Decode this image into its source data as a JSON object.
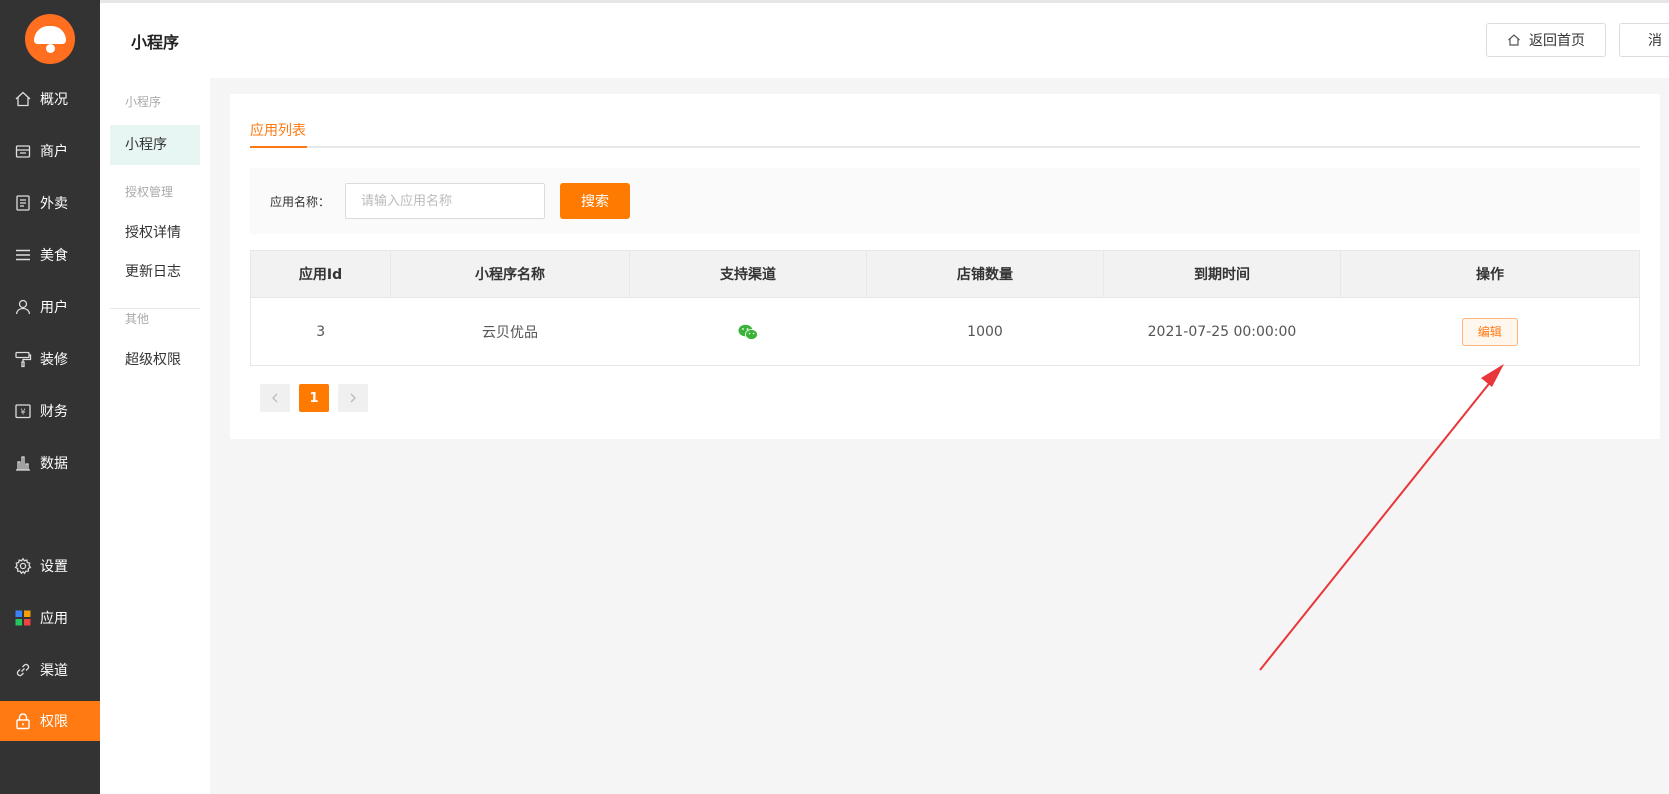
{
  "sidebar": {
    "items": [
      {
        "label": "概况",
        "icon": "home-icon"
      },
      {
        "label": "商户",
        "icon": "store-icon"
      },
      {
        "label": "外卖",
        "icon": "document-icon"
      },
      {
        "label": "美食",
        "icon": "menu-icon"
      },
      {
        "label": "用户",
        "icon": "user-icon"
      },
      {
        "label": "装修",
        "icon": "paint-roller-icon"
      },
      {
        "label": "财务",
        "icon": "wallet-icon"
      },
      {
        "label": "数据",
        "icon": "bar-chart-icon"
      },
      {
        "label": "设置",
        "icon": "gear-icon"
      },
      {
        "label": "应用",
        "icon": "apps-icon"
      },
      {
        "label": "渠道",
        "icon": "link-icon"
      },
      {
        "label": "权限",
        "icon": "lock-icon",
        "active": true
      }
    ],
    "accent_color": "#ff7a12"
  },
  "header": {
    "title": "小程序",
    "home_button": "返回首页",
    "notice_button": "消"
  },
  "subnav": {
    "group_miniapp": "小程序",
    "item_miniapp": "小程序",
    "group_auth": "授权管理",
    "item_auth_detail": "授权详情",
    "item_changelog": "更新日志",
    "group_other": "其他",
    "item_super": "超级权限"
  },
  "main": {
    "tab_label": "应用列表",
    "search": {
      "label": "应用名称：",
      "placeholder": "请输入应用名称",
      "button": "搜索"
    },
    "table": {
      "columns": [
        "应用Id",
        "小程序名称",
        "支持渠道",
        "店铺数量",
        "到期时间",
        "操作"
      ],
      "rows": [
        {
          "id": "3",
          "name": "云贝优品",
          "channel_icon": "wechat-icon",
          "stores": "1000",
          "expire": "2021-07-25 00:00:00",
          "action": "编辑"
        }
      ]
    },
    "pagination": {
      "current": "1"
    }
  }
}
